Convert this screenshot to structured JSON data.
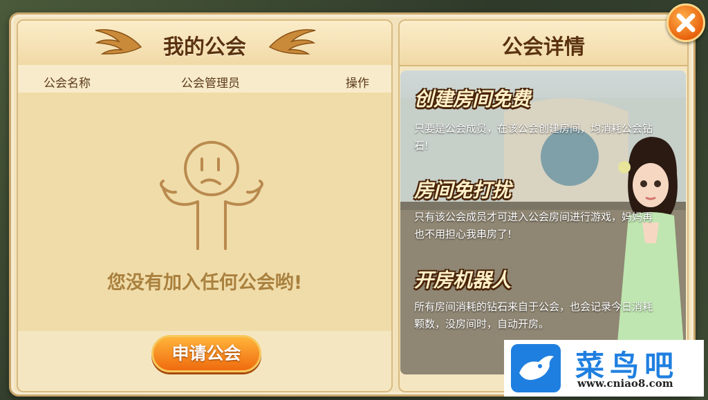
{
  "left_panel": {
    "title": "我的公会",
    "columns": [
      "公会名称",
      "公会管理员",
      "操作"
    ],
    "empty_message": "您没有加入任何公会哟!",
    "apply_button": "申请公会"
  },
  "right_panel": {
    "title": "公会详情",
    "features": [
      {
        "title": "创建房间免费",
        "desc": "只要是公会成员，在该公会创建房间，均消耗公会钻石!"
      },
      {
        "title": "房间免打扰",
        "desc": "只有该公会成员才可进入公会房间进行游戏，妈妈再也不用担心我串房了!"
      },
      {
        "title": "开房机器人",
        "desc": "所有房间消耗的钻石来自于公会，也会记录今日消耗颗数，没房间时，自动开房。"
      }
    ]
  },
  "close_button": {
    "icon": "close-icon"
  },
  "watermark": {
    "name": "菜鸟吧",
    "url": "www.cniao8.com"
  },
  "colors": {
    "accent": "#ef6b0f",
    "panel": "#f5e6c2",
    "title_text": "#5a3210",
    "empty_text": "#a9803e"
  }
}
